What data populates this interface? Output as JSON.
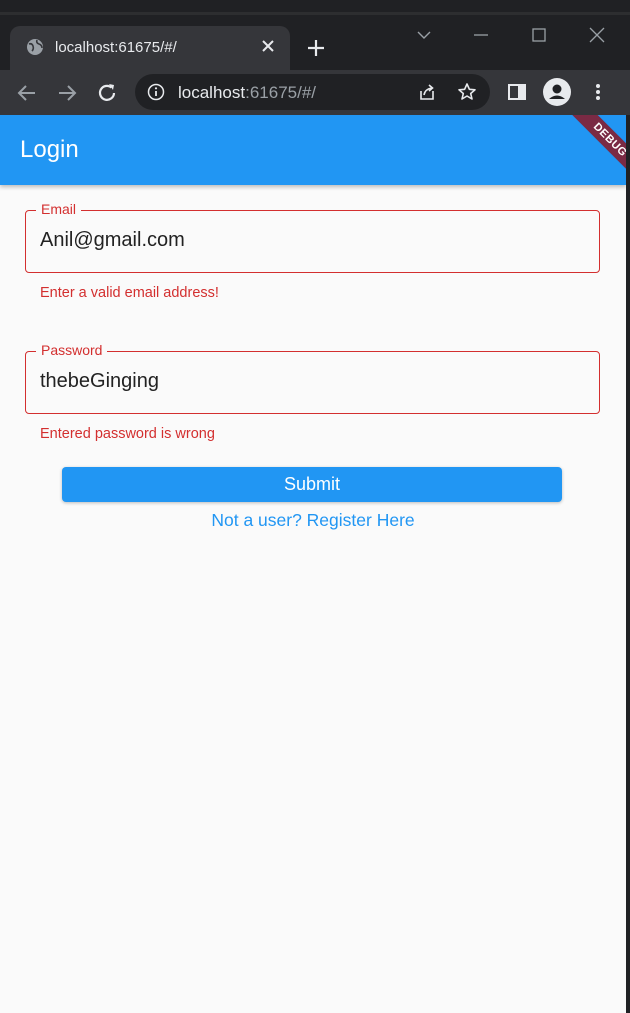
{
  "browser": {
    "tab_title": "localhost:61675/#/",
    "url_host": "localhost",
    "url_rest": ":61675/#/"
  },
  "app": {
    "title": "Login",
    "debug_banner": "DEBUG",
    "accent_color": "#2196f3",
    "error_color": "#d32f2f"
  },
  "form": {
    "email": {
      "label": "Email",
      "value": "Anil@gmail.com",
      "error": "Enter a valid email address!"
    },
    "password": {
      "label": "Password",
      "value": "thebeGinging",
      "error": "Entered password is wrong"
    },
    "submit_label": "Submit",
    "register_link": "Not a user? Register Here"
  },
  "icons": [
    "globe-icon",
    "close-icon",
    "plus-icon",
    "chevron-down-icon",
    "minimize-icon",
    "maximize-icon",
    "window-close-icon",
    "back-icon",
    "forward-icon",
    "reload-icon",
    "info-icon",
    "share-icon",
    "star-icon",
    "side-panel-icon",
    "profile-icon",
    "more-icon"
  ]
}
